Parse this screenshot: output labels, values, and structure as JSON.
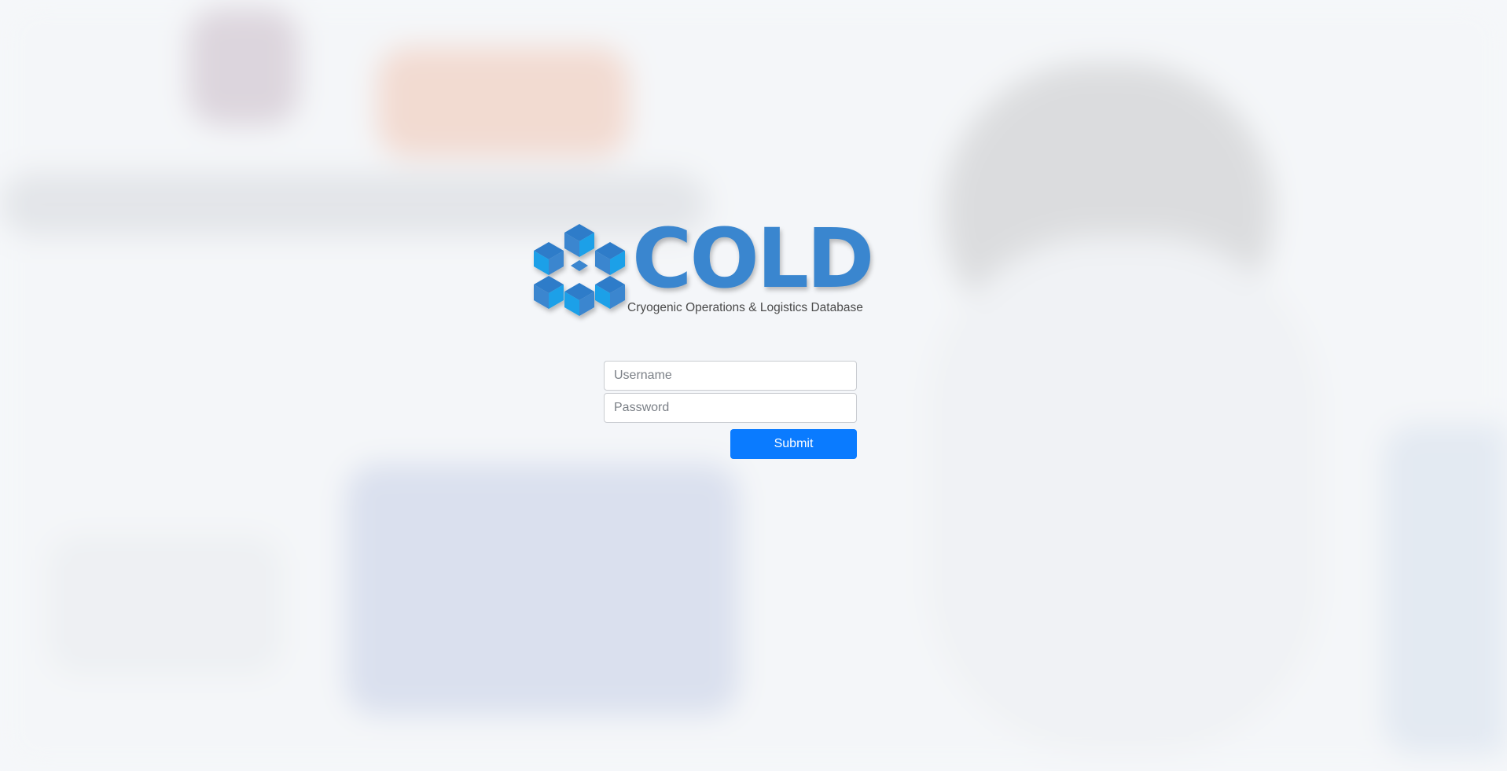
{
  "logo": {
    "name": "COLD",
    "tagline": "Cryogenic Operations & Logistics Database",
    "icon": "snowflake-hexagon-icon",
    "color": "#3a86cf",
    "accent_color": "#1aa0e8"
  },
  "login_form": {
    "username_placeholder": "Username",
    "password_placeholder": "Password",
    "submit_label": "Submit",
    "submit_color": "#0a7bff"
  },
  "background": {
    "description_icon": "laboratory-photo-background"
  }
}
